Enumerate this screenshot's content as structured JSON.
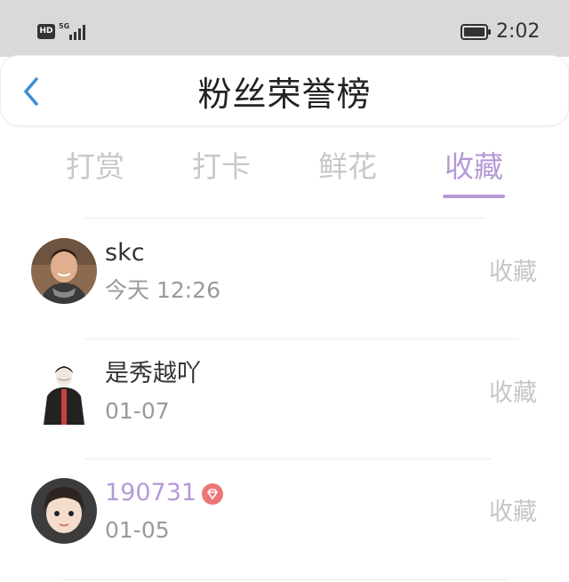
{
  "status_bar": {
    "hd": "HD",
    "network": "5G",
    "time": "2:02"
  },
  "header": {
    "title": "粉丝荣誉榜",
    "back_icon": "chevron-left-icon"
  },
  "tabs": [
    {
      "label": "打赏",
      "active": false
    },
    {
      "label": "打卡",
      "active": false
    },
    {
      "label": "鲜花",
      "active": false
    },
    {
      "label": "收藏",
      "active": true
    }
  ],
  "colors": {
    "accent": "#b69ad6",
    "back_icon": "#3a8fd8",
    "vip_badge": "#ec7676",
    "inactive_text": "#c8c8c8"
  },
  "fans": [
    {
      "name": "skc",
      "time": "今天 12:26",
      "action": "收藏",
      "vip": false,
      "avatar": "avatar-photo-man-scarf"
    },
    {
      "name": "是秀越吖",
      "time": "01-07",
      "action": "收藏",
      "vip": false,
      "avatar": "avatar-illustration-person-black-coat"
    },
    {
      "name": "190731",
      "time": "01-05",
      "action": "收藏",
      "vip": true,
      "avatar": "avatar-photo-child"
    }
  ]
}
